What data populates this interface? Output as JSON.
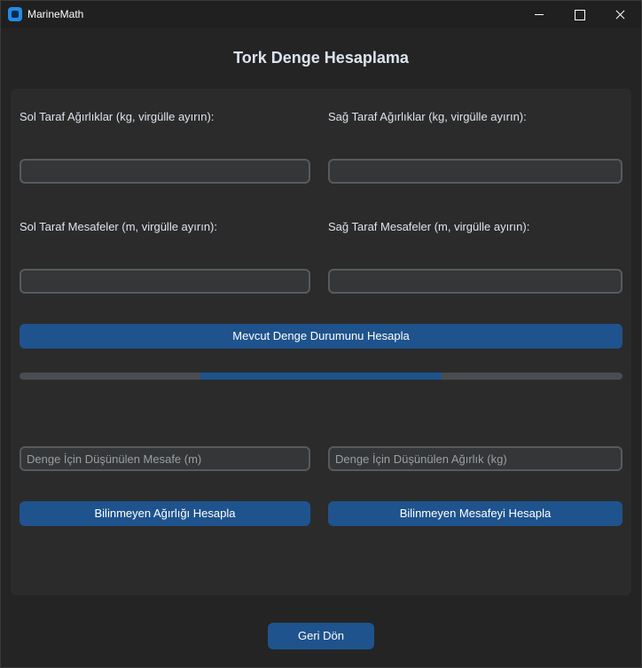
{
  "window": {
    "title": "MarineMath",
    "controls": [
      "minimize",
      "maximize",
      "close"
    ]
  },
  "page": {
    "title": "Tork Denge Hesaplama"
  },
  "form": {
    "left_weights_label": "Sol Taraf Ağırlıklar (kg, virgülle ayırın):",
    "right_weights_label": "Sağ Taraf Ağırlıklar (kg, virgülle ayırın):",
    "left_distances_label": "Sol Taraf Mesafeler (m, virgülle ayırın):",
    "right_distances_label": "Sağ Taraf Mesafeler (m, virgülle ayırın):",
    "left_weights_value": "",
    "right_weights_value": "",
    "left_distances_value": "",
    "right_distances_value": "",
    "calculate_balance_label": "Mevcut Denge Durumunu Hesapla"
  },
  "progress": {
    "mode": "indeterminate",
    "fill_start_fraction": 0.3,
    "fill_end_fraction": 0.7
  },
  "unknowns": {
    "distance_placeholder": "Denge İçin Düşünülen Mesafe (m)",
    "weight_placeholder": "Denge İçin Düşünülen Ağırlık (kg)",
    "calc_weight_label": "Bilinmeyen Ağırlığı Hesapla",
    "calc_distance_label": "Bilinmeyen Mesafeyi Hesapla"
  },
  "footer": {
    "back_label": "Geri Dön"
  },
  "colors": {
    "background": "#242424",
    "panel": "#2b2b2b",
    "accent": "#1f538d",
    "entry_bg": "#343638",
    "entry_border": "#565b5e",
    "text": "#dce4ee"
  }
}
